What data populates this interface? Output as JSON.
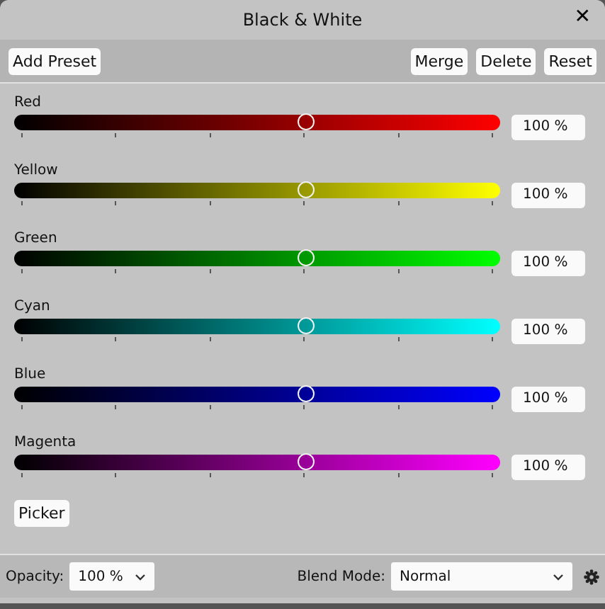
{
  "window": {
    "title": "Black & White",
    "close": "✕"
  },
  "toolbar": {
    "left": [
      "Add Preset"
    ],
    "right": [
      "Merge",
      "Delete",
      "Reset"
    ]
  },
  "channels": [
    {
      "name": "Red",
      "color": "#ff0000",
      "level": 0.6,
      "reading": "100 %"
    },
    {
      "name": "Yellow",
      "color": "#ffff00",
      "level": 0.6,
      "reading": "100 %"
    },
    {
      "name": "Green",
      "color": "#00ff00",
      "level": 0.6,
      "reading": "100 %"
    },
    {
      "name": "Cyan",
      "color": "#00ffff",
      "level": 0.6,
      "reading": "100 %"
    },
    {
      "name": "Blue",
      "color": "#0000ff",
      "level": 0.6,
      "reading": "100 %"
    },
    {
      "name": "Magenta",
      "color": "#ff00ff",
      "level": 0.6,
      "reading": "100 %"
    }
  ],
  "picker": "Picker",
  "footer": {
    "opacity_label": "Opacity:",
    "opacity": "100 %",
    "blend_label": "Blend Mode:",
    "blend": "Normal"
  }
}
